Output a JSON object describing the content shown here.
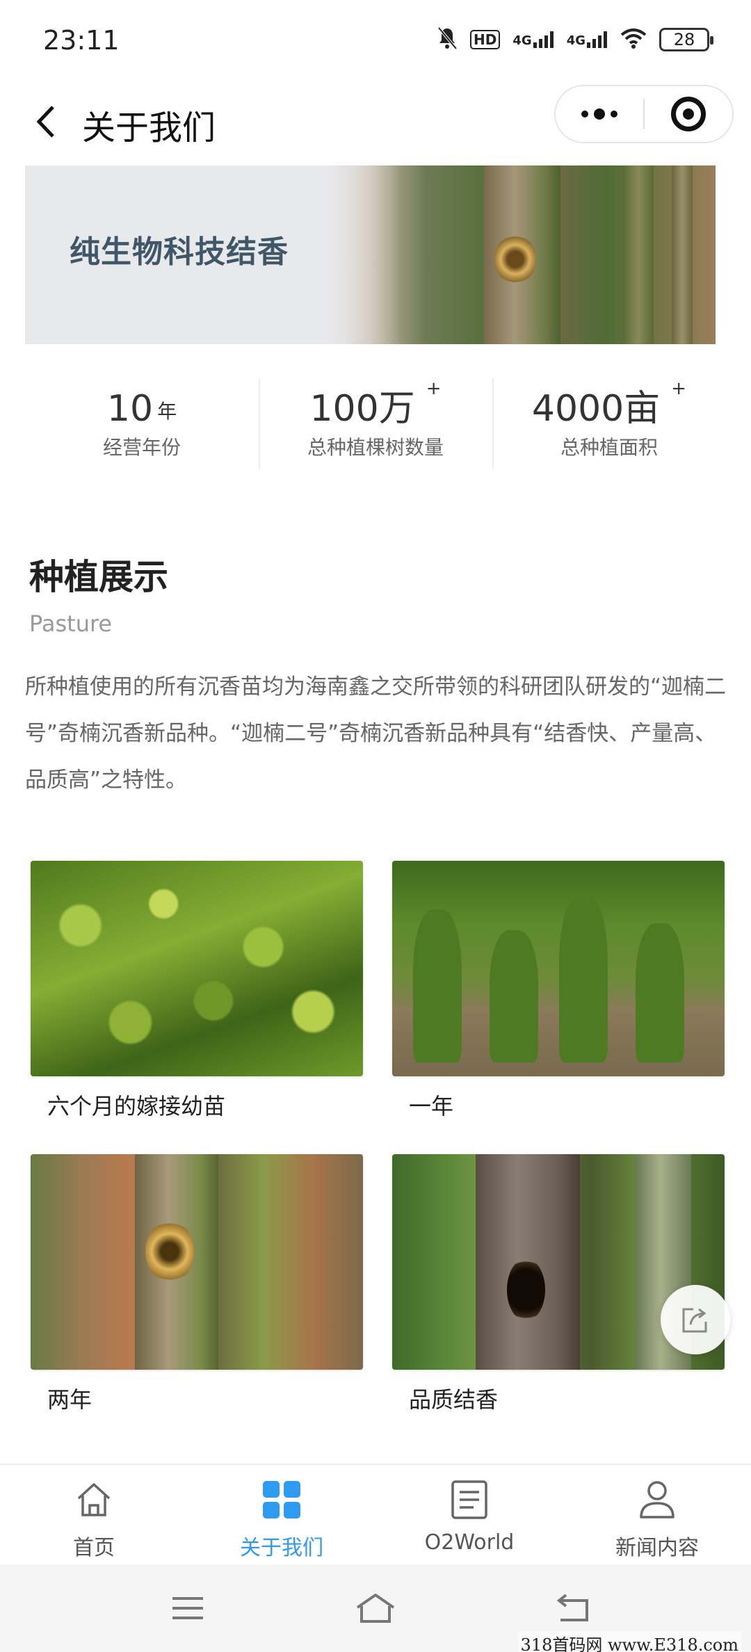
{
  "status_bar": {
    "time": "23:11",
    "icons": [
      "mute-bell-icon",
      "hd-icon",
      "4g-signal-icon",
      "4g-signal-icon",
      "wifi-icon"
    ],
    "hd_label": "HD",
    "net1": "4G",
    "net2": "4G",
    "battery": "28"
  },
  "header": {
    "title": "关于我们"
  },
  "banner": {
    "title": "纯生物科技结香"
  },
  "stats": [
    {
      "value": "10",
      "unit": "年",
      "plus": "",
      "label": "经营年份"
    },
    {
      "value": "100万",
      "unit": "",
      "plus": "+",
      "label": "总种植棵树数量"
    },
    {
      "value": "4000亩",
      "unit": "",
      "plus": "+",
      "label": "总种植面积"
    }
  ],
  "section": {
    "title": "种植展示",
    "subtitle": "Pasture",
    "description": "所种植使用的所有沉香苗均为海南鑫之交所带领的科研团队研发的“迦楠二号”奇楠沉香新品种。“迦楠二号”奇楠沉香新品种具有“结香快、产量高、品质高”之特性。"
  },
  "gallery": [
    {
      "caption": "六个月的嫁接幼苗"
    },
    {
      "caption": "一年"
    },
    {
      "caption": "两年"
    },
    {
      "caption": "品质结香"
    }
  ],
  "tabbar": {
    "items": [
      {
        "label": "首页",
        "icon": "home-icon",
        "active": false
      },
      {
        "label": "关于我们",
        "icon": "grid-icon",
        "active": true
      },
      {
        "label": "O2World",
        "icon": "document-icon",
        "active": false
      },
      {
        "label": "新闻内容",
        "icon": "user-icon",
        "active": false
      }
    ],
    "active_color": "#2f9bf0"
  },
  "watermark": "318首码网 www.E318.com"
}
